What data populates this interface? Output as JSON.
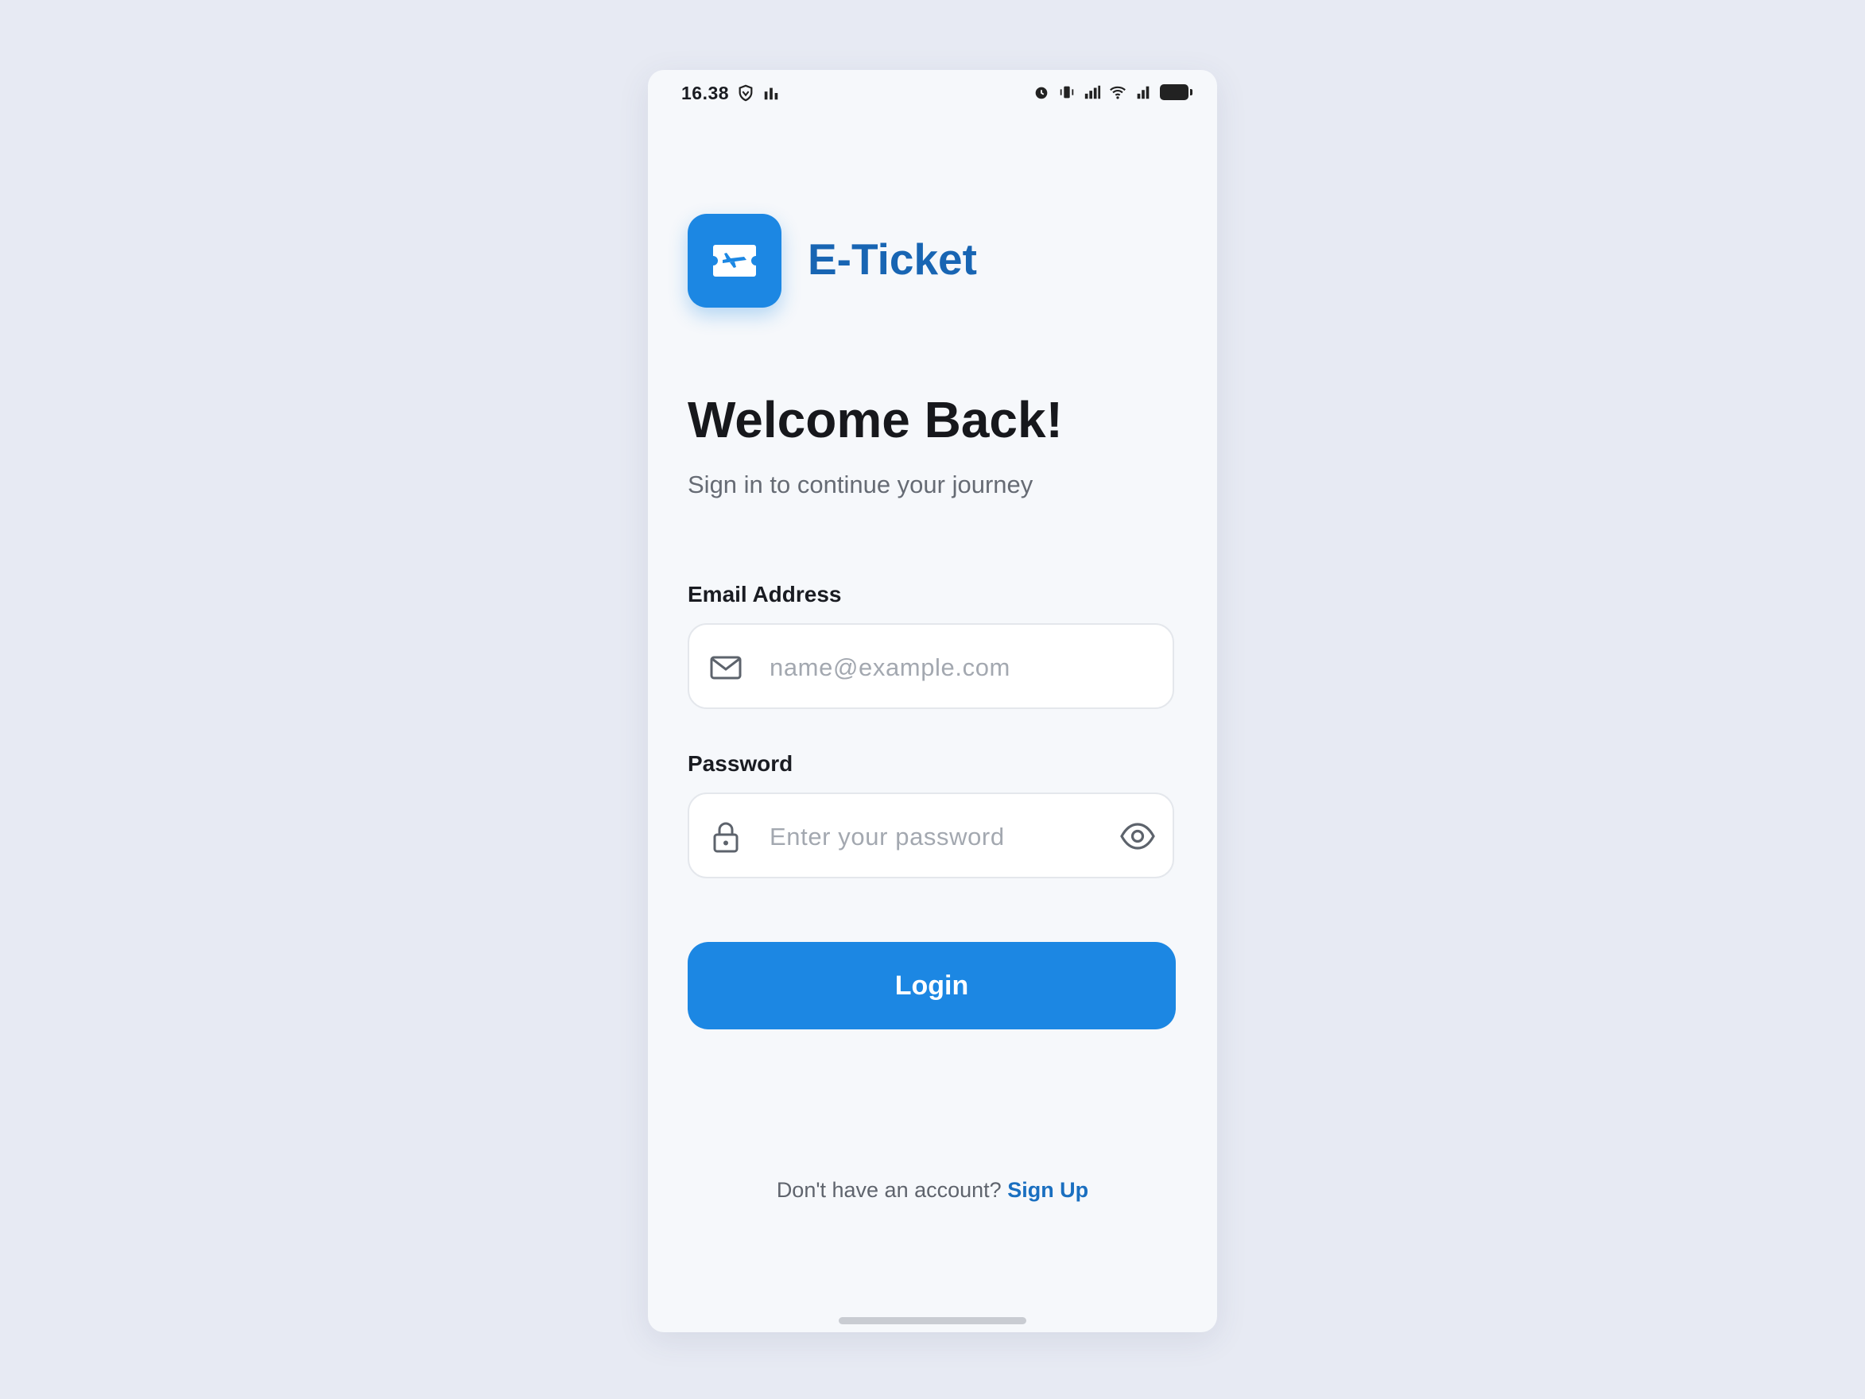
{
  "status_bar": {
    "time": "16.38"
  },
  "app": {
    "name": "E-Ticket",
    "brand_color": "#1c87e3",
    "name_color": "#1865b3"
  },
  "welcome": {
    "title": "Welcome Back!",
    "subtitle": "Sign in to continue your journey"
  },
  "email": {
    "label": "Email Address",
    "placeholder": "name@example.com",
    "icon": "mail-icon"
  },
  "password": {
    "label": "Password",
    "placeholder": "Enter your password",
    "icon": "lock-icon",
    "toggle_icon": "eye-icon"
  },
  "login": {
    "label": "Login"
  },
  "signup": {
    "prompt": "Don't have an account?",
    "link": "Sign Up"
  }
}
